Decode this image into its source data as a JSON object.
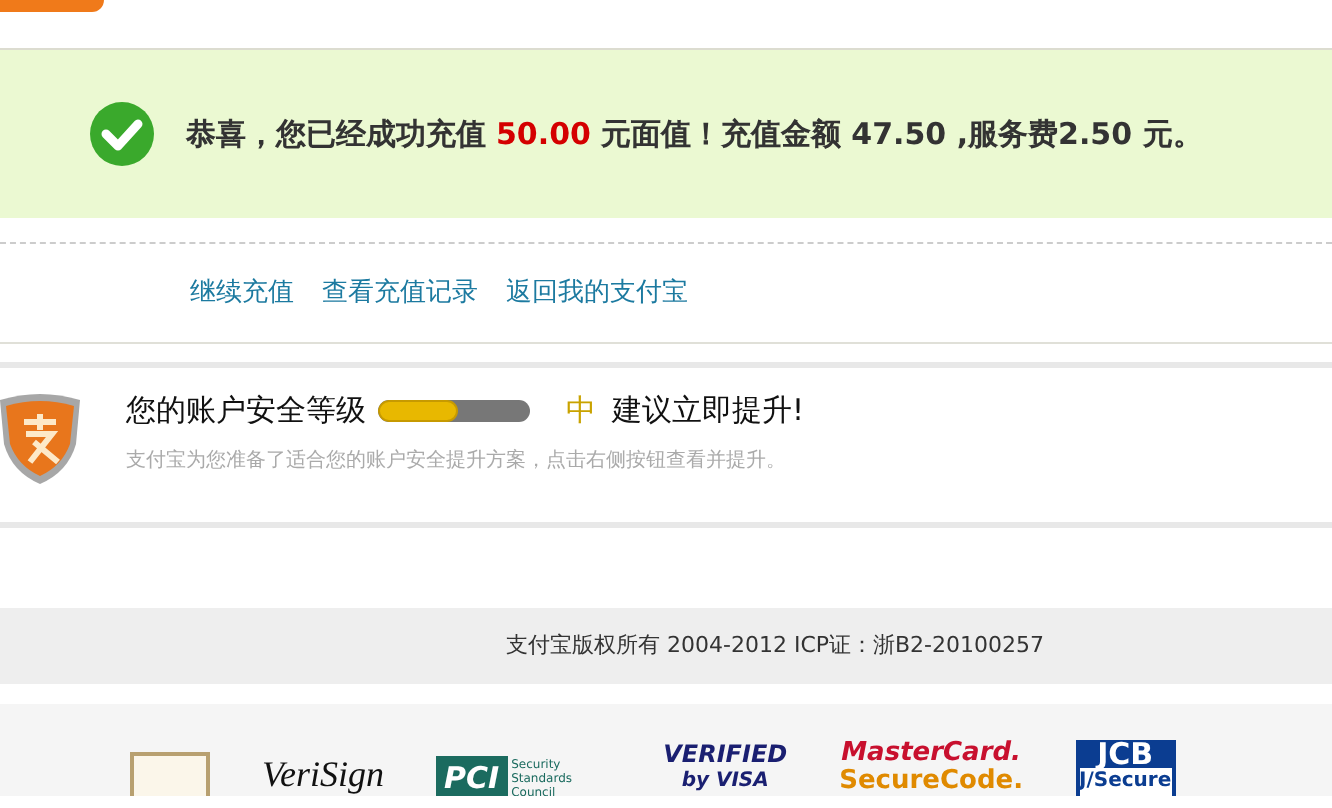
{
  "result": {
    "message": [
      {
        "kind": "text",
        "text": "恭喜，您已经成功充值"
      },
      {
        "kind": "amount",
        "text": "50.00"
      },
      {
        "kind": "text",
        "text": "元面值！充值金额 47.50 ,服务费2.50 元。"
      }
    ]
  },
  "links": [
    "继续充值",
    "查看充值记录",
    "返回我的支付宝"
  ],
  "security": {
    "label": "您的账户安全等级",
    "level": 0.53,
    "grade": "中",
    "advice": "建议立即提升!",
    "note": "支付宝为您准备了适合您的账户安全提升方案，点击右侧按钮查看并提升。"
  },
  "footer": {
    "copyright": "支付宝版权所有 2004-2012 ICP证：浙B2-20100257"
  },
  "badges": [
    {
      "kind": "seal"
    },
    {
      "kind": "verisign",
      "text": "VeriSign"
    },
    {
      "kind": "pci",
      "text": "PCI",
      "sub": "Security Standards Council"
    },
    {
      "kind": "visa",
      "text": "VERIFIED",
      "sub": "by VISA"
    },
    {
      "kind": "mastercard",
      "text": "MasterCard.",
      "sub": "SecureCode."
    },
    {
      "kind": "jcb",
      "text": "JCB",
      "sub": "J/Secure"
    }
  ]
}
